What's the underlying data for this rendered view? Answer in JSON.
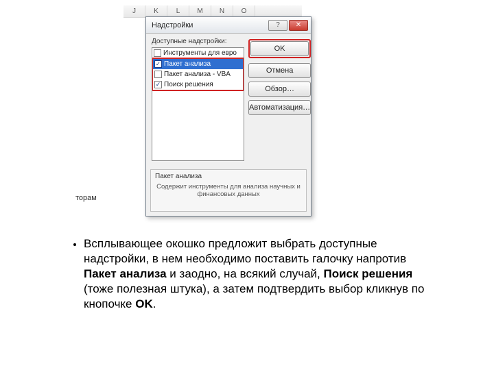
{
  "columns": [
    "J",
    "K",
    "L",
    "M",
    "N",
    "O"
  ],
  "left_text": "торам",
  "dialog": {
    "title": "Надстройки",
    "help_glyph": "?",
    "close_glyph": "✕",
    "available_label": "Доступные надстройки:",
    "items": [
      {
        "label": "Инструменты для евро",
        "checked": false,
        "selected": false,
        "red": false
      },
      {
        "label": "Пакет анализа",
        "checked": true,
        "selected": true,
        "red": true
      },
      {
        "label": "Пакет анализа - VBA",
        "checked": false,
        "selected": false,
        "red": true
      },
      {
        "label": "Поиск решения",
        "checked": true,
        "selected": false,
        "red": true
      }
    ],
    "buttons": {
      "ok": "OK",
      "cancel": "Отмена",
      "browse": "Обзор…",
      "automation": "Автоматизация…"
    },
    "desc_title": "Пакет анализа",
    "desc_body": "Содержит инструменты для анализа научных и финансовых данных"
  },
  "bullet": {
    "t1": "Всплывающее окошко предложит выбрать доступные надстройки, в нем необходимо поставить галочку напротив ",
    "b1": "Пакет анализа",
    "t2": " и заодно, на всякий случай, ",
    "b2": "Поиск решения",
    "t3": " (тоже полезная штука), а затем подтвердить выбор кликнув по кнопочке ",
    "b3": "OK",
    "t4": "."
  }
}
